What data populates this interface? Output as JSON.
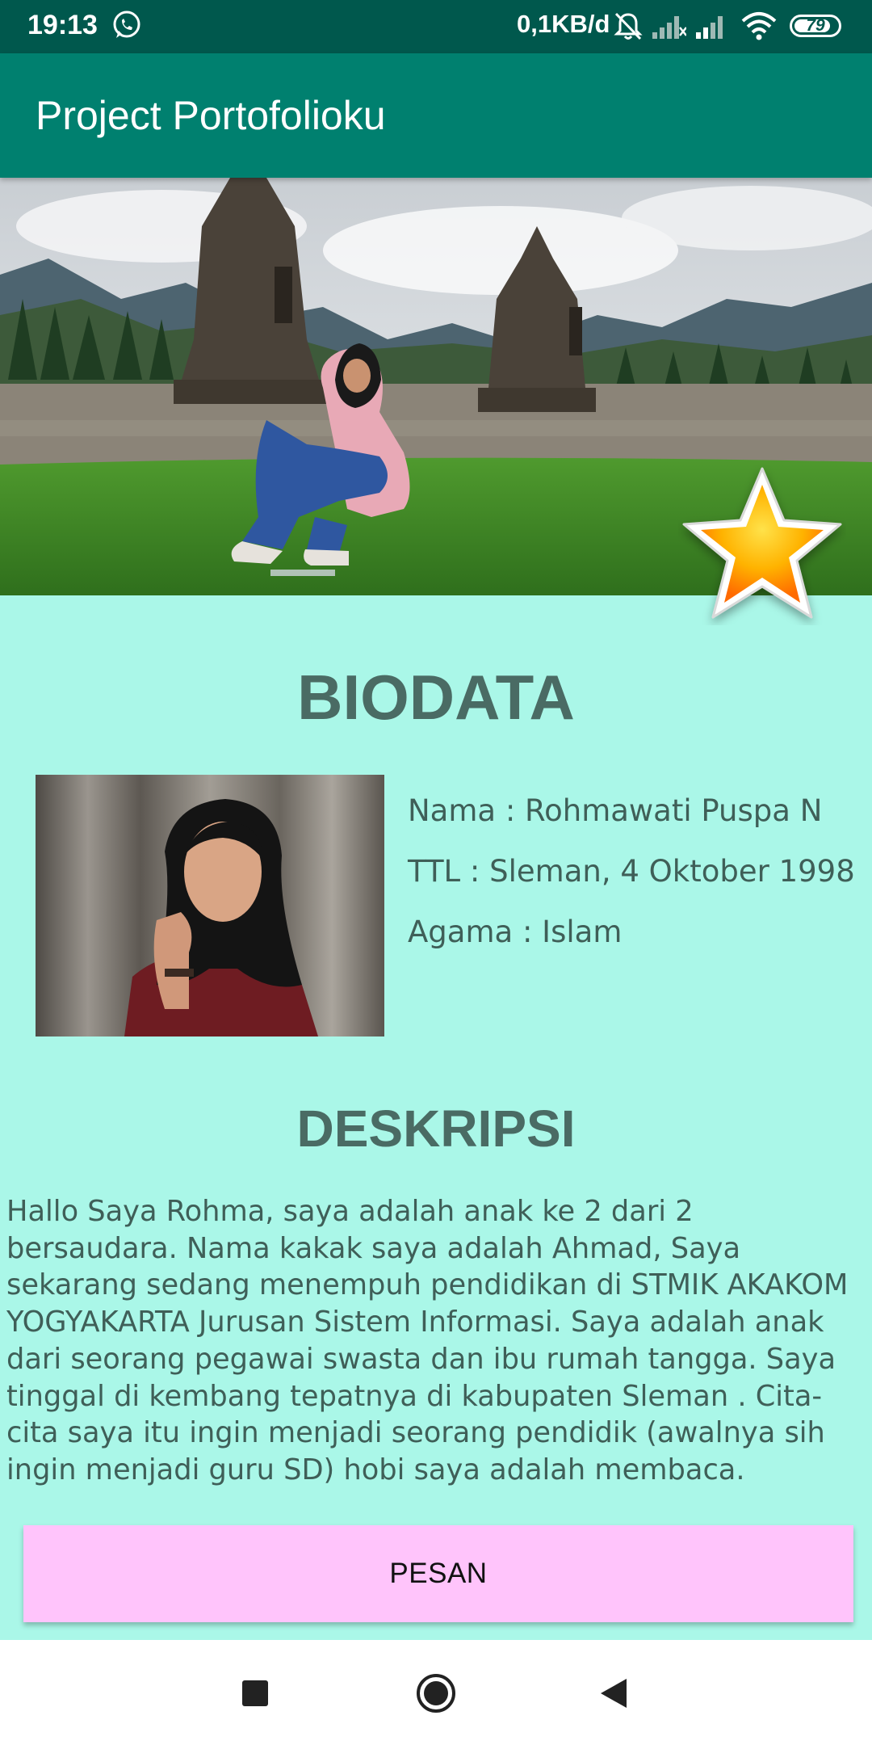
{
  "status_bar": {
    "time": "19:13",
    "data_rate": "0,1KB/d",
    "battery": "79",
    "icons": [
      "whatsapp-icon",
      "mute-icon",
      "signal-icon",
      "signal-icon",
      "wifi-icon",
      "battery-icon"
    ]
  },
  "app_bar": {
    "title": "Project Portofolioku"
  },
  "biodata": {
    "title": "BIODATA",
    "name": "Nama : Rohmawati Puspa N",
    "ttl": "TTL : Sleman, 4 Oktober 1998",
    "agama": "Agama : Islam"
  },
  "deskripsi": {
    "title": "DESKRIPSI",
    "body": "Hallo Saya Rohma, saya adalah anak ke 2 dari 2 bersaudara. Nama kakak saya adalah Ahmad, Saya sekarang sedang menempuh pendidikan di STMIK AKAKOM YOGYAKARTA Jurusan Sistem Informasi. Saya adalah anak dari seorang pegawai swasta dan ibu rumah tangga. Saya tinggal di kembang tepatnya di kabupaten Sleman . Cita-cita saya itu ingin menjadi seorang pendidik (awalnya sih ingin menjadi guru SD) hobi saya adalah membaca."
  },
  "button": {
    "pesan_label": "PESAN"
  },
  "colors": {
    "status_bar": "#00584d",
    "app_bar": "#00806f",
    "background": "#aaf7e8",
    "button": "#ffc4fb",
    "heading_text": "#4a6b64"
  }
}
